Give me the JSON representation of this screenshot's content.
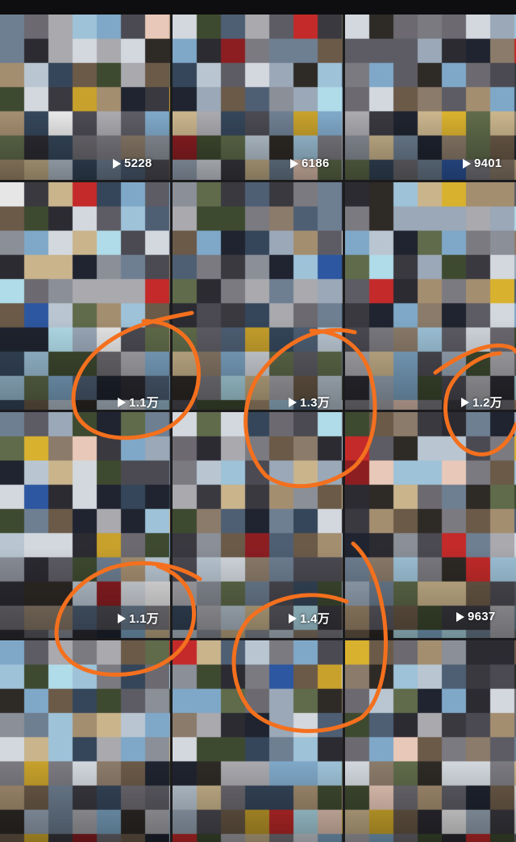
{
  "grid": {
    "columns": 3,
    "tiles": [
      {
        "views": "5228"
      },
      {
        "views": "6186"
      },
      {
        "views": "9401"
      },
      {
        "views": "1.1万"
      },
      {
        "views": "1.3万"
      },
      {
        "views": "1.2万"
      },
      {
        "views": "1.1万"
      },
      {
        "views": "1.4万"
      },
      {
        "views": "9637"
      },
      {
        "views": ""
      },
      {
        "views": ""
      },
      {
        "views": ""
      }
    ]
  },
  "annotations": {
    "color": "#f4701e",
    "circled_tiles": [
      3,
      4,
      5,
      6,
      7
    ]
  },
  "colors": {
    "background": "#1c1c1e",
    "top_bar": "#0e0e10",
    "view_text": "#ffffff"
  }
}
